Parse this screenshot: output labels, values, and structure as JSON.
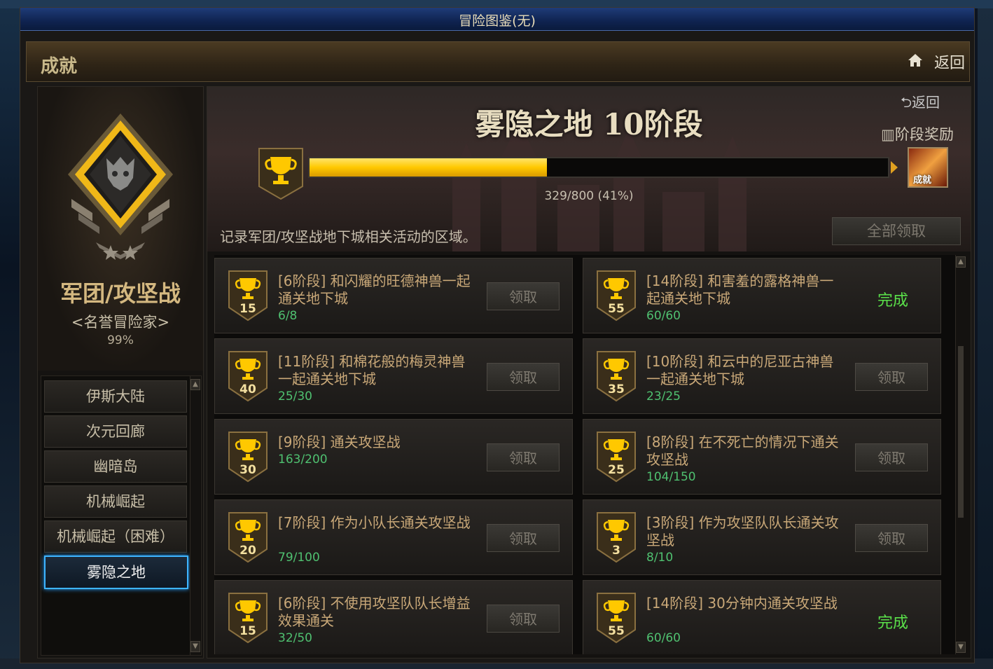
{
  "window": {
    "title": "冒险图鉴(无)"
  },
  "header": {
    "section_title": "成就",
    "back_label": "返回"
  },
  "left": {
    "category_name": "军团/攻坚战",
    "category_title": "<名誉冒险家>",
    "category_percent": "99%",
    "nav": [
      "伊斯大陆",
      "次元回廊",
      "幽暗岛",
      "机械崛起",
      "机械崛起（困难）",
      "雾隐之地"
    ],
    "active_index": 5
  },
  "stage": {
    "title": "雾隐之地 10阶段",
    "return_label": "返回",
    "reward_label": "阶段奖励",
    "reward_badge_text": "成就",
    "progress_text": "329/800 (41%)",
    "progress_fraction": 0.41,
    "description": "记录军团/攻坚战地下城相关活动的区域。",
    "claim_all_label": "全部领取"
  },
  "claim_label": "领取",
  "complete_label": "完成",
  "achievements": [
    {
      "points": "15",
      "title": "[6阶段] 和闪耀的旺德神兽一起通关地下城",
      "progress": "6/8",
      "state": "claim"
    },
    {
      "points": "55",
      "title": "[14阶段] 和害羞的露格神兽一起通关地下城",
      "progress": "60/60",
      "state": "complete"
    },
    {
      "points": "40",
      "title": "[11阶段] 和棉花般的梅灵神兽一起通关地下城",
      "progress": "25/30",
      "state": "claim"
    },
    {
      "points": "35",
      "title": "[10阶段] 和云中的尼亚古神兽一起通关地下城",
      "progress": "23/25",
      "state": "claim"
    },
    {
      "points": "30",
      "title": "[9阶段] 通关攻坚战",
      "progress": "163/200",
      "state": "claim"
    },
    {
      "points": "25",
      "title": "[8阶段] 在不死亡的情况下通关攻坚战",
      "progress": "104/150",
      "state": "claim"
    },
    {
      "points": "20",
      "title": "[7阶段] 作为小队长通关攻坚战",
      "progress": "79/100",
      "state": "claim"
    },
    {
      "points": "3",
      "title": "[3阶段] 作为攻坚队队长通关攻坚战",
      "progress": "8/10",
      "state": "claim"
    },
    {
      "points": "15",
      "title": "[6阶段] 不使用攻坚队队长增益效果通关",
      "progress": "32/50",
      "state": "claim"
    },
    {
      "points": "55",
      "title": "[14阶段] 30分钟内通关攻坚战",
      "progress": "60/60",
      "state": "complete"
    }
  ],
  "colors": {
    "accent_gold": "#ffc800",
    "complete_green": "#5ae04a",
    "progress_green": "#4fc070",
    "active_nav_border": "#3db4ff"
  },
  "icons": {
    "home": "home-icon",
    "return": "return-arrow-icon",
    "reward": "gift-icon",
    "trophy": "trophy-icon",
    "scroll_up": "chevron-up-icon",
    "scroll_down": "chevron-down-icon"
  }
}
